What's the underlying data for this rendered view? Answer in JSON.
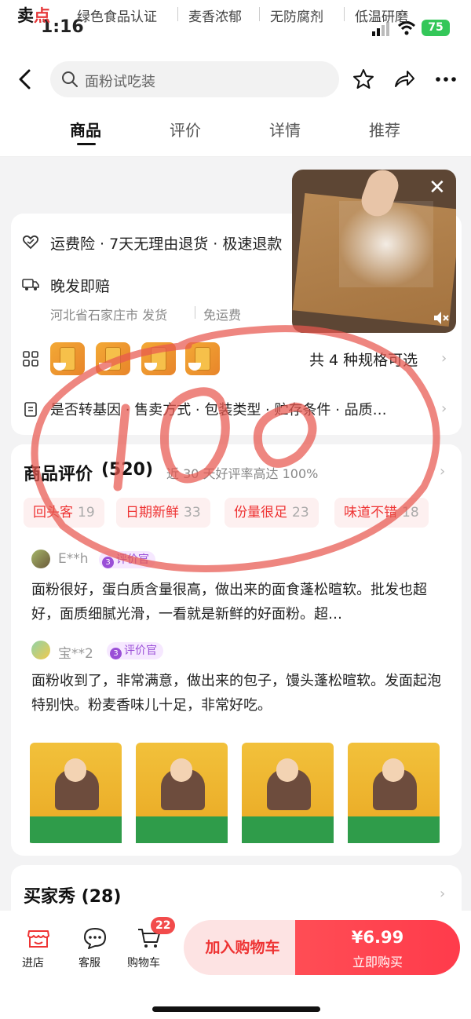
{
  "status_bar": {
    "time": "1:16",
    "battery": "75"
  },
  "search": {
    "query": "面粉试吃装"
  },
  "tabs": [
    {
      "label": "商品"
    },
    {
      "label": "评价"
    },
    {
      "label": "详情"
    },
    {
      "label": "推荐"
    }
  ],
  "selling_points": {
    "title_part1": "卖",
    "title_part2": "点",
    "items": [
      "绿色食品认证",
      "麦香浓郁",
      "无防腐剂",
      "低温研磨"
    ]
  },
  "service": {
    "insurance": "运费险 · 7天无理由退货 · 极速退款",
    "late_comp": "晚发即赔",
    "ship_from": "河北省石家庄市 发货",
    "free_ship": "免运费",
    "specs": "共 4 种规格可选",
    "attributes": "是否转基因 · 售卖方式 · 包装类型 · 贮存条件 · 品质…"
  },
  "annotation": {
    "handwritten": "100"
  },
  "reviews": {
    "title": "商品评价",
    "count": "(520)",
    "rate_text": "近 30 天好评率高达 100%",
    "tags": [
      {
        "label": "回头客",
        "count": "19"
      },
      {
        "label": "日期新鲜",
        "count": "33"
      },
      {
        "label": "份量很足",
        "count": "23"
      },
      {
        "label": "味道不错",
        "count": "18"
      }
    ],
    "items": [
      {
        "user": "E**h",
        "badge_level": "3",
        "badge": "评价官",
        "text": "面粉很好，蛋白质含量很高，做出来的面食蓬松暄软。批发也超好，面质细腻光滑，一看就是新鲜的好面粉。超…"
      },
      {
        "user": "宝**2",
        "badge_level": "3",
        "badge": "评价官",
        "text": "面粉收到了，非常满意，做出来的包子，馒头蓬松暄软。发面起泡特别快。粉麦香味儿十足，非常好吃。"
      }
    ]
  },
  "buyer_show": {
    "title": "买家秀 (28)"
  },
  "bottom_bar": {
    "store": "进店",
    "service": "客服",
    "cart": "购物车",
    "cart_count": "22",
    "add_cart": "加入购物车",
    "price": "¥6.99",
    "buy_now": "立即购买"
  },
  "colors": {
    "accent": "#ff3b4b",
    "tag_red": "#e33333",
    "badge_purple": "#9a4fd7"
  }
}
